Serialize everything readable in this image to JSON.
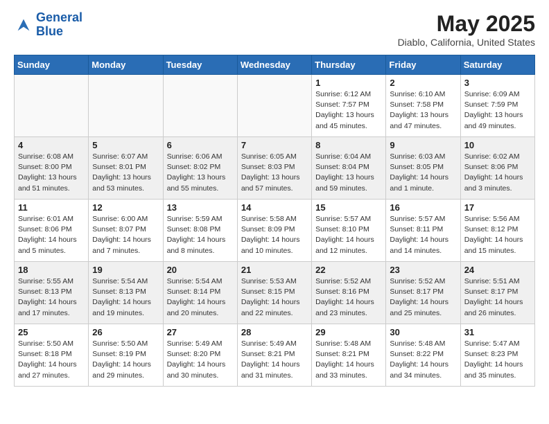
{
  "header": {
    "logo_line1": "General",
    "logo_line2": "Blue",
    "title": "May 2025",
    "subtitle": "Diablo, California, United States"
  },
  "weekdays": [
    "Sunday",
    "Monday",
    "Tuesday",
    "Wednesday",
    "Thursday",
    "Friday",
    "Saturday"
  ],
  "weeks": [
    [
      {
        "day": "",
        "info": ""
      },
      {
        "day": "",
        "info": ""
      },
      {
        "day": "",
        "info": ""
      },
      {
        "day": "",
        "info": ""
      },
      {
        "day": "1",
        "info": "Sunrise: 6:12 AM\nSunset: 7:57 PM\nDaylight: 13 hours\nand 45 minutes."
      },
      {
        "day": "2",
        "info": "Sunrise: 6:10 AM\nSunset: 7:58 PM\nDaylight: 13 hours\nand 47 minutes."
      },
      {
        "day": "3",
        "info": "Sunrise: 6:09 AM\nSunset: 7:59 PM\nDaylight: 13 hours\nand 49 minutes."
      }
    ],
    [
      {
        "day": "4",
        "info": "Sunrise: 6:08 AM\nSunset: 8:00 PM\nDaylight: 13 hours\nand 51 minutes."
      },
      {
        "day": "5",
        "info": "Sunrise: 6:07 AM\nSunset: 8:01 PM\nDaylight: 13 hours\nand 53 minutes."
      },
      {
        "day": "6",
        "info": "Sunrise: 6:06 AM\nSunset: 8:02 PM\nDaylight: 13 hours\nand 55 minutes."
      },
      {
        "day": "7",
        "info": "Sunrise: 6:05 AM\nSunset: 8:03 PM\nDaylight: 13 hours\nand 57 minutes."
      },
      {
        "day": "8",
        "info": "Sunrise: 6:04 AM\nSunset: 8:04 PM\nDaylight: 13 hours\nand 59 minutes."
      },
      {
        "day": "9",
        "info": "Sunrise: 6:03 AM\nSunset: 8:05 PM\nDaylight: 14 hours\nand 1 minute."
      },
      {
        "day": "10",
        "info": "Sunrise: 6:02 AM\nSunset: 8:06 PM\nDaylight: 14 hours\nand 3 minutes."
      }
    ],
    [
      {
        "day": "11",
        "info": "Sunrise: 6:01 AM\nSunset: 8:06 PM\nDaylight: 14 hours\nand 5 minutes."
      },
      {
        "day": "12",
        "info": "Sunrise: 6:00 AM\nSunset: 8:07 PM\nDaylight: 14 hours\nand 7 minutes."
      },
      {
        "day": "13",
        "info": "Sunrise: 5:59 AM\nSunset: 8:08 PM\nDaylight: 14 hours\nand 8 minutes."
      },
      {
        "day": "14",
        "info": "Sunrise: 5:58 AM\nSunset: 8:09 PM\nDaylight: 14 hours\nand 10 minutes."
      },
      {
        "day": "15",
        "info": "Sunrise: 5:57 AM\nSunset: 8:10 PM\nDaylight: 14 hours\nand 12 minutes."
      },
      {
        "day": "16",
        "info": "Sunrise: 5:57 AM\nSunset: 8:11 PM\nDaylight: 14 hours\nand 14 minutes."
      },
      {
        "day": "17",
        "info": "Sunrise: 5:56 AM\nSunset: 8:12 PM\nDaylight: 14 hours\nand 15 minutes."
      }
    ],
    [
      {
        "day": "18",
        "info": "Sunrise: 5:55 AM\nSunset: 8:13 PM\nDaylight: 14 hours\nand 17 minutes."
      },
      {
        "day": "19",
        "info": "Sunrise: 5:54 AM\nSunset: 8:13 PM\nDaylight: 14 hours\nand 19 minutes."
      },
      {
        "day": "20",
        "info": "Sunrise: 5:54 AM\nSunset: 8:14 PM\nDaylight: 14 hours\nand 20 minutes."
      },
      {
        "day": "21",
        "info": "Sunrise: 5:53 AM\nSunset: 8:15 PM\nDaylight: 14 hours\nand 22 minutes."
      },
      {
        "day": "22",
        "info": "Sunrise: 5:52 AM\nSunset: 8:16 PM\nDaylight: 14 hours\nand 23 minutes."
      },
      {
        "day": "23",
        "info": "Sunrise: 5:52 AM\nSunset: 8:17 PM\nDaylight: 14 hours\nand 25 minutes."
      },
      {
        "day": "24",
        "info": "Sunrise: 5:51 AM\nSunset: 8:17 PM\nDaylight: 14 hours\nand 26 minutes."
      }
    ],
    [
      {
        "day": "25",
        "info": "Sunrise: 5:50 AM\nSunset: 8:18 PM\nDaylight: 14 hours\nand 27 minutes."
      },
      {
        "day": "26",
        "info": "Sunrise: 5:50 AM\nSunset: 8:19 PM\nDaylight: 14 hours\nand 29 minutes."
      },
      {
        "day": "27",
        "info": "Sunrise: 5:49 AM\nSunset: 8:20 PM\nDaylight: 14 hours\nand 30 minutes."
      },
      {
        "day": "28",
        "info": "Sunrise: 5:49 AM\nSunset: 8:21 PM\nDaylight: 14 hours\nand 31 minutes."
      },
      {
        "day": "29",
        "info": "Sunrise: 5:48 AM\nSunset: 8:21 PM\nDaylight: 14 hours\nand 33 minutes."
      },
      {
        "day": "30",
        "info": "Sunrise: 5:48 AM\nSunset: 8:22 PM\nDaylight: 14 hours\nand 34 minutes."
      },
      {
        "day": "31",
        "info": "Sunrise: 5:47 AM\nSunset: 8:23 PM\nDaylight: 14 hours\nand 35 minutes."
      }
    ]
  ]
}
